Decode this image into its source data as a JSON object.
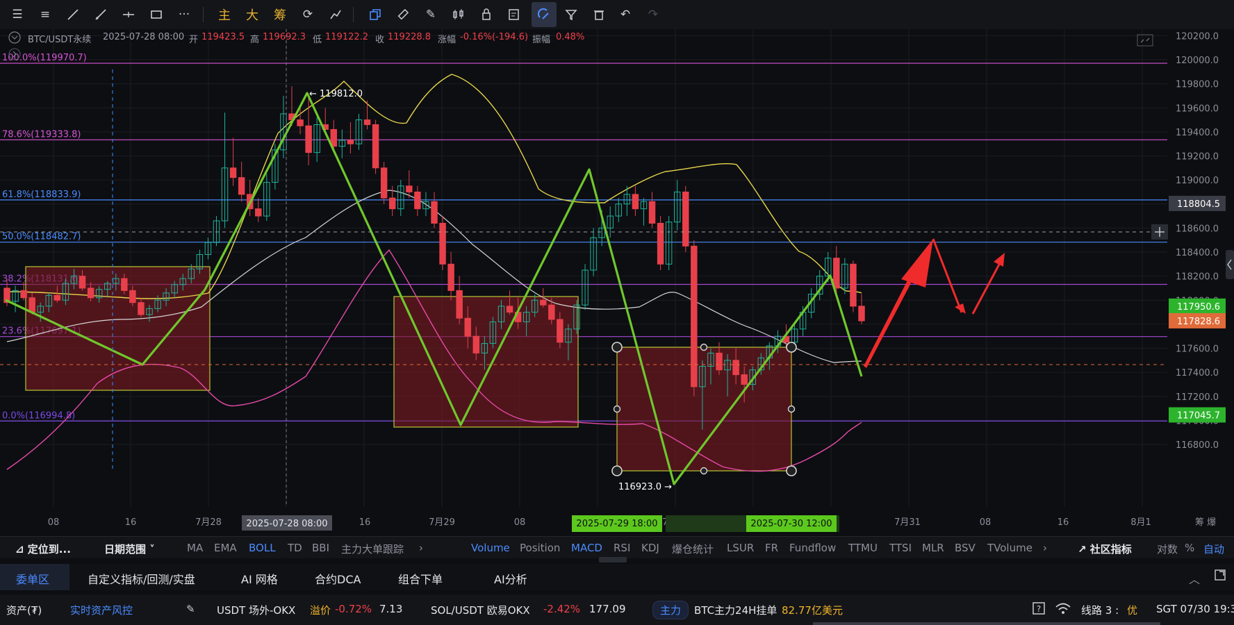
{
  "toolbar": {
    "tools": [
      "menu-icon",
      "list-icon",
      "line-icon",
      "ray-icon",
      "horizontal-line-icon",
      "rect-icon",
      "more-icon"
    ],
    "zhu_label": "主",
    "da_label": "大",
    "chou_label": "筹"
  },
  "info": {
    "symbol": "BTC/USDT永续",
    "datetime": "2025-07-28 08:00",
    "open_label": "开",
    "open_value": "119423.5",
    "high_label": "高",
    "high_value": "119692.3",
    "low_label": "低",
    "low_value": "119122.2",
    "close_label": "收",
    "close_value": "119228.8",
    "change_label": "涨幅",
    "change_value": "-0.16%(-194.6)",
    "amp_label": "振幅",
    "amp_value": "0.48%"
  },
  "chart_data": {
    "type": "candlestick",
    "y_ticks": [
      "120200.0",
      "120000.0",
      "119800.0",
      "119600.0",
      "119400.0",
      "119200.0",
      "119000.0",
      "118800.0",
      "118600.0",
      "118400.0",
      "118200.0",
      "118000.0",
      "117800.0",
      "117600.0",
      "117400.0",
      "117200.0",
      "117000.0",
      "116800.0"
    ],
    "ylim": [
      116700,
      120300
    ],
    "x_ticks": [
      "08",
      "16",
      "7月28",
      "16",
      "7月29",
      "08",
      "7月30",
      "7月31",
      "08",
      "16",
      "8月1"
    ],
    "crosshair_x_label": "2025-07-28 08:00",
    "range_start_label": "2025-07-29 18:00",
    "range_end_label": "2025-07-30 12:00",
    "fib_levels": [
      {
        "label": "100.0%(119970.7)",
        "price": 119970.7,
        "color": "#d654d6"
      },
      {
        "label": "78.6%(119333.8)",
        "price": 119333.8,
        "color": "#d654d6"
      },
      {
        "label": "61.8%(118833.9)",
        "price": 118833.9,
        "color": "#4a8cff"
      },
      {
        "label": "50.0%(118482.7)",
        "price": 118482.7,
        "color": "#4a8cff"
      },
      {
        "label": "38.2%(118131.6)",
        "price": 118131.6,
        "color": "#a64ad6"
      },
      {
        "label": "23.6%(117697.1)",
        "price": 117697.1,
        "color": "#a64ad6"
      },
      {
        "label": "0.0%(116994.8)",
        "price": 116994.8,
        "color": "#7a4ae6"
      }
    ],
    "peak_label": "← 119812.0",
    "trough_label": "116923.0 →",
    "price_tags": [
      {
        "value": "118804.5",
        "price": 118804.5,
        "color": "#3a3d45"
      },
      {
        "value": "117950.6",
        "price": 117950.6,
        "color": "#2db42d"
      },
      {
        "value": "117828.6",
        "price": 117828.6,
        "color": "#e06b3a"
      },
      {
        "value": "117045.7",
        "price": 117045.7,
        "color": "#2db42d"
      }
    ],
    "candles": [
      [
        118100,
        118180,
        117950,
        117980
      ],
      [
        117990,
        118120,
        117900,
        118080
      ],
      [
        118080,
        118150,
        118000,
        118020
      ],
      [
        118020,
        118060,
        117880,
        117900
      ],
      [
        117900,
        117980,
        117820,
        117950
      ],
      [
        117950,
        118060,
        117900,
        118040
      ],
      [
        118040,
        118120,
        117980,
        118000
      ],
      [
        118000,
        118180,
        117960,
        118140
      ],
      [
        118140,
        118260,
        118090,
        118200
      ],
      [
        118200,
        118250,
        118080,
        118100
      ],
      [
        118100,
        118150,
        117990,
        118020
      ],
      [
        118020,
        118120,
        117980,
        118090
      ],
      [
        118090,
        118160,
        118020,
        118140
      ],
      [
        118140,
        118220,
        118080,
        118180
      ],
      [
        118180,
        118220,
        118050,
        118080
      ],
      [
        118080,
        118120,
        117950,
        117980
      ],
      [
        117980,
        118020,
        117860,
        117880
      ],
      [
        117880,
        117960,
        117820,
        117930
      ],
      [
        117930,
        118040,
        117900,
        118000
      ],
      [
        118000,
        118100,
        117950,
        118060
      ],
      [
        118060,
        118160,
        118020,
        118130
      ],
      [
        118130,
        118220,
        118080,
        118180
      ],
      [
        118180,
        118300,
        118140,
        118260
      ],
      [
        118260,
        118420,
        118220,
        118380
      ],
      [
        118380,
        118520,
        118340,
        118480
      ],
      [
        118480,
        118700,
        118450,
        118660
      ],
      [
        118660,
        119560,
        118600,
        119100
      ],
      [
        119100,
        119350,
        118950,
        119020
      ],
      [
        119020,
        119150,
        118820,
        118880
      ],
      [
        118880,
        119000,
        118700,
        118760
      ],
      [
        118760,
        118850,
        118650,
        118700
      ],
      [
        118700,
        119050,
        118660,
        118980
      ],
      [
        118980,
        119300,
        118920,
        119250
      ],
      [
        119250,
        119700,
        119180,
        119550
      ],
      [
        119550,
        119780,
        119450,
        119500
      ],
      [
        119500,
        119620,
        119380,
        119450
      ],
      [
        119450,
        119692,
        119122,
        119228
      ],
      [
        119228,
        119520,
        119150,
        119460
      ],
      [
        119460,
        119600,
        119380,
        119420
      ],
      [
        119420,
        119500,
        119250,
        119280
      ],
      [
        119280,
        119420,
        119180,
        119330
      ],
      [
        119330,
        119480,
        119220,
        119300
      ],
      [
        119300,
        119550,
        119250,
        119500
      ],
      [
        119500,
        119660,
        119420,
        119460
      ],
      [
        119460,
        119500,
        119050,
        119100
      ],
      [
        119100,
        119150,
        118800,
        118850
      ],
      [
        118850,
        118950,
        118700,
        118760
      ],
      [
        118760,
        119000,
        118700,
        118950
      ],
      [
        118950,
        119080,
        118850,
        118900
      ],
      [
        118900,
        118950,
        118700,
        118760
      ],
      [
        118760,
        118900,
        118700,
        118820
      ],
      [
        118820,
        118900,
        118600,
        118640
      ],
      [
        118640,
        118700,
        118250,
        118300
      ],
      [
        118300,
        118400,
        118000,
        118080
      ],
      [
        118080,
        118200,
        117800,
        117850
      ],
      [
        117850,
        117950,
        117600,
        117700
      ],
      [
        117700,
        117780,
        117500,
        117560
      ],
      [
        117560,
        117700,
        117420,
        117640
      ],
      [
        117640,
        117860,
        117600,
        117820
      ],
      [
        117820,
        118000,
        117760,
        117950
      ],
      [
        117950,
        118080,
        117880,
        117900
      ],
      [
        117900,
        118020,
        117760,
        117820
      ],
      [
        117820,
        117950,
        117700,
        117900
      ],
      [
        117900,
        118050,
        117860,
        118000
      ],
      [
        118000,
        118100,
        117940,
        117960
      ],
      [
        117960,
        118020,
        117800,
        117840
      ],
      [
        117840,
        117900,
        117600,
        117650
      ],
      [
        117650,
        117800,
        117500,
        117760
      ],
      [
        117760,
        118000,
        117720,
        117960
      ],
      [
        117960,
        118300,
        117920,
        118250
      ],
      [
        118250,
        118600,
        118200,
        118520
      ],
      [
        118520,
        118750,
        118450,
        118600
      ],
      [
        118600,
        118780,
        118520,
        118700
      ],
      [
        118700,
        118850,
        118650,
        118800
      ],
      [
        118800,
        118950,
        118700,
        118880
      ],
      [
        118880,
        118950,
        118700,
        118760
      ],
      [
        118760,
        118850,
        118620,
        118820
      ],
      [
        118820,
        118900,
        118600,
        118640
      ],
      [
        118640,
        118700,
        118250,
        118300
      ],
      [
        118300,
        118700,
        118250,
        118650
      ],
      [
        118650,
        119000,
        118580,
        118900
      ],
      [
        118900,
        118950,
        118400,
        118450
      ],
      [
        118450,
        118500,
        117200,
        117280
      ],
      [
        117280,
        117500,
        116923,
        117450
      ],
      [
        117450,
        117600,
        117300,
        117560
      ],
      [
        117560,
        117650,
        117380,
        117420
      ],
      [
        117420,
        117550,
        117200,
        117500
      ],
      [
        117500,
        117600,
        117300,
        117380
      ],
      [
        117380,
        117450,
        117150,
        117300
      ],
      [
        117300,
        117450,
        117250,
        117420
      ],
      [
        117420,
        117560,
        117380,
        117520
      ],
      [
        117520,
        117650,
        117420,
        117620
      ],
      [
        117620,
        117750,
        117560,
        117700
      ],
      [
        117700,
        117800,
        117600,
        117650
      ],
      [
        117650,
        117800,
        117580,
        117760
      ],
      [
        117760,
        117950,
        117700,
        117900
      ],
      [
        117900,
        118100,
        117850,
        118050
      ],
      [
        118050,
        118250,
        118000,
        118200
      ],
      [
        118200,
        118400,
        118150,
        118350
      ],
      [
        118350,
        118450,
        118050,
        118100
      ],
      [
        118100,
        118350,
        118050,
        118300
      ],
      [
        118300,
        118330,
        117900,
        117950
      ],
      [
        117950,
        118050,
        117800,
        117828
      ]
    ]
  },
  "indicators": {
    "locate_label": "定位到...",
    "date_range_label": "日期范围",
    "main_items": [
      "MA",
      "EMA",
      "BOLL",
      "TD",
      "BBI",
      "主力大单跟踪"
    ],
    "active_main": "BOLL",
    "sub_items": [
      "Volume",
      "Position",
      "MACD",
      "RSI",
      "KDJ",
      "爆仓统计",
      "LSUR",
      "FR",
      "Fundflow",
      "TTMU",
      "TTSI",
      "MLR",
      "BSV",
      "TVolume"
    ],
    "active_subs": [
      "Volume",
      "MACD"
    ],
    "community_label": "社区指标",
    "log_label": "对数",
    "pct_label": "%",
    "auto_label": "自动"
  },
  "bottom_tabs": {
    "items": [
      "委单区",
      "自定义指标/回测/实盘",
      "AI 网格",
      "合约DCA",
      "组合下单",
      "AI分析"
    ],
    "active": "委单区"
  },
  "status": {
    "assets_label": "资产(₮)",
    "risk_label": "实时资产风控",
    "usdt_label": "USDT 场外-OKX",
    "premium_label": "溢价",
    "premium_value": "-0.72%",
    "usdt_price": "7.13",
    "sol_label": "SOL/USDT 欧易OKX",
    "sol_change": "-2.42%",
    "sol_price": "177.09",
    "main_force_badge": "主力",
    "btc_orders_label": "BTC主力24H挂单",
    "btc_orders_value": "82.77亿美元",
    "line_label": "线路 3 :",
    "line_quality": "优",
    "time_label": "SGT 07/30 19:3"
  }
}
